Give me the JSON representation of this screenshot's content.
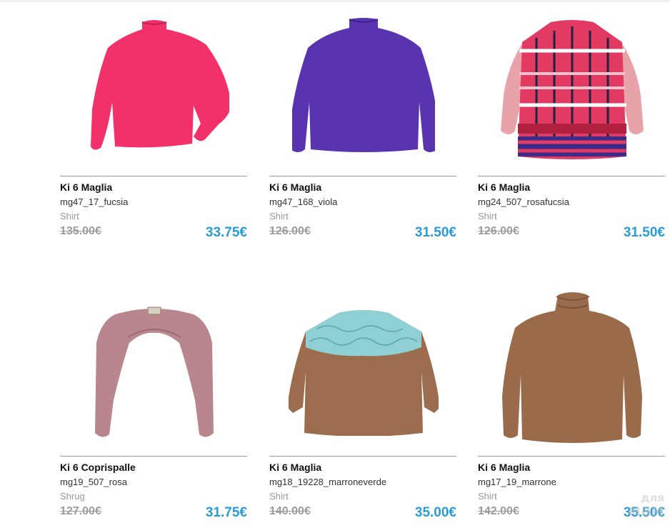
{
  "theme": {
    "price_color": "#2a9bd6"
  },
  "products": [
    {
      "brand": "Ki 6 Maglia",
      "code": "mg47_17_fucsia",
      "category": "Shirt",
      "old_price": "135.00€",
      "new_price": "33.75€",
      "image": "fuchsia-turtleneck-sweater",
      "color": "#f2306a"
    },
    {
      "brand": "Ki 6 Maglia",
      "code": "mg47_168_viola",
      "category": "Shirt",
      "old_price": "126.00€",
      "new_price": "31.50€",
      "image": "violet-turtleneck-sweater",
      "color": "#5a34b0"
    },
    {
      "brand": "Ki 6 Maglia",
      "code": "mg24_507_rosafucsia",
      "category": "Shirt",
      "old_price": "126.00€",
      "new_price": "31.50€",
      "image": "pink-patterned-tunic-sweater",
      "color": "#e8637f"
    },
    {
      "brand": "Ki 6 Coprispalle",
      "code": "mg19_507_rosa",
      "category": "Shrug",
      "old_price": "127.00€",
      "new_price": "31.75€",
      "image": "pink-knit-shrug",
      "color": "#b8868c"
    },
    {
      "brand": "Ki 6 Maglia",
      "code": "mg18_19228_marroneverde",
      "category": "Shirt",
      "old_price": "140.00€",
      "new_price": "35.00€",
      "image": "brown-sweater-with-lace-yoke",
      "color": "#9b6d4e"
    },
    {
      "brand": "Ki 6 Maglia",
      "code": "mg17_19_marrone",
      "category": "Shirt",
      "old_price": "142.00€",
      "new_price": "35.50€",
      "image": "brown-turtleneck-sweater",
      "color": "#9a6b4b"
    }
  ],
  "watermark": {
    "line1": "для",
    "line2": "мам"
  }
}
